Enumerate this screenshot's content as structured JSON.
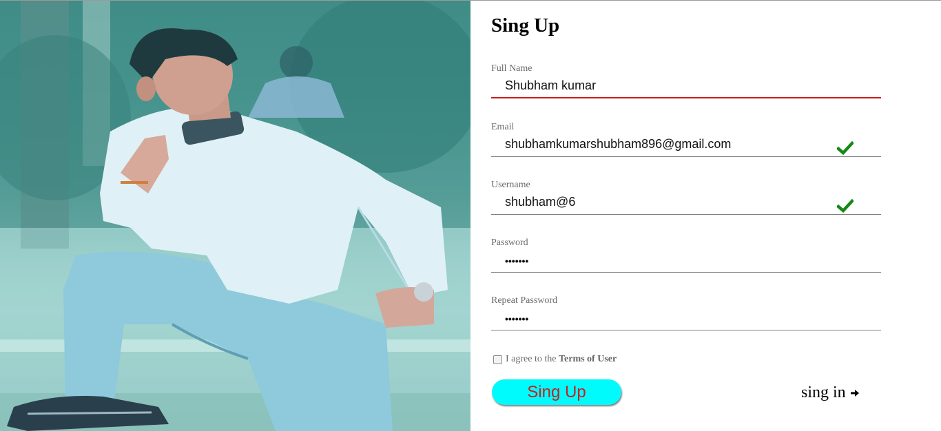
{
  "form": {
    "title": "Sing Up",
    "fields": [
      {
        "label": "Full Name",
        "value": "Shubham kumar",
        "state": "error"
      },
      {
        "label": "Email",
        "value": "shubhamkumarshubham896@gmail.com",
        "state": "valid"
      },
      {
        "label": "Username",
        "value": "shubham@6",
        "state": "valid"
      },
      {
        "label": "Password",
        "value": "•••••••",
        "state": "normal"
      },
      {
        "label": "Repeat Password",
        "value": "•••••••",
        "state": "normal"
      }
    ],
    "agree": {
      "prefix": "I agree to the ",
      "link": "Terms of User",
      "checked": false
    },
    "signup_button": "Sing Up",
    "signin_link": "sing in"
  },
  "icons": {
    "valid": "checkmark-icon",
    "signin_arrow": "arrow-right-icon"
  },
  "colors": {
    "button_bg": "#00fbfd",
    "button_text": "#c62020",
    "error_underline": "#cc1a1a",
    "valid_check": "#138a13",
    "photo_tint": "#4e9d97"
  }
}
